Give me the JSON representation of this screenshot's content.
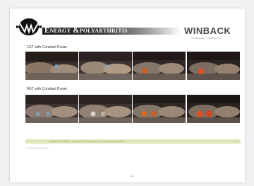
{
  "header": {
    "title": "Energy &polyarthritis",
    "brand": "WINBACK",
    "brand_subtitle": "STIMULANT L'EVOLUTIF"
  },
  "sections": [
    {
      "label": "CET with Constant Power"
    },
    {
      "label": "RET with Constant Power"
    }
  ],
  "footer": {
    "text": "WINBACK TRAINING · Fabien a LGD Toulouse Toulouse · Winback Sud Pauline",
    "number": "15"
  },
  "comment_label": "COMMENTAIRE :",
  "page_number": "16",
  "colors": {
    "title_bar": "#1a1a1a",
    "footer_bar": "#dfe6b8",
    "heat_spot": "#e0501e"
  }
}
